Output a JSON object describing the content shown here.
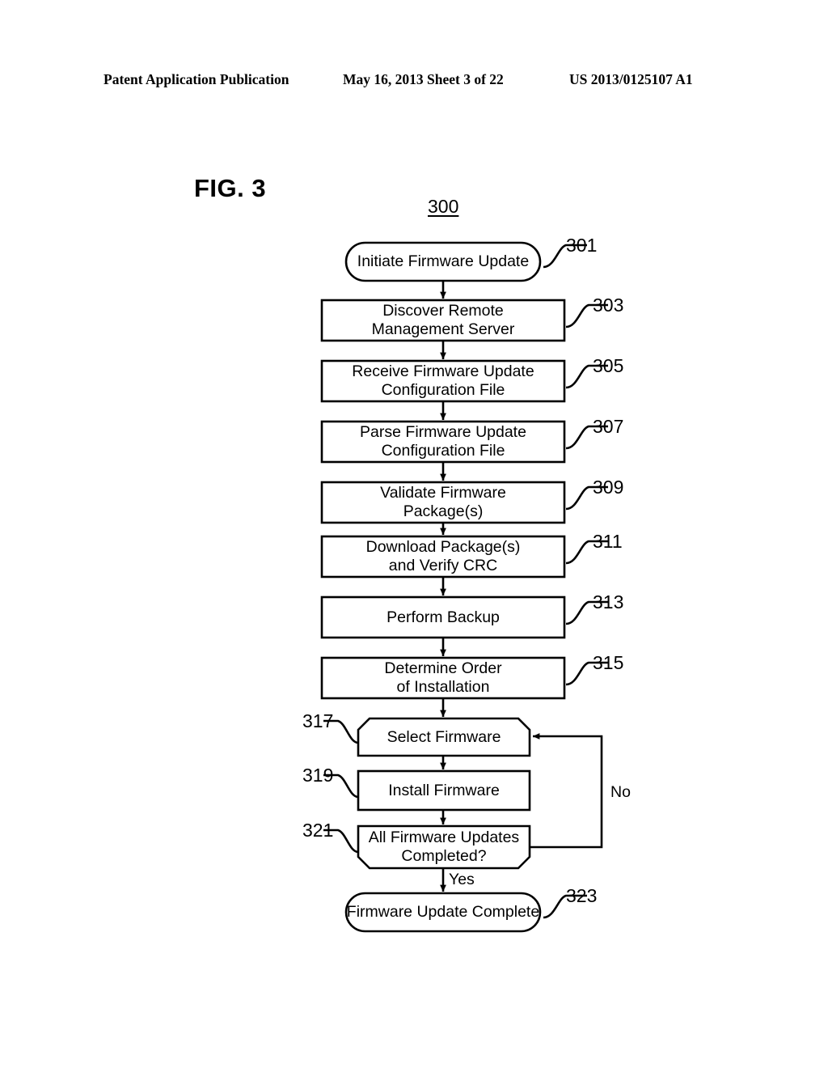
{
  "header": {
    "publication": "Patent Application Publication",
    "date_sheet": "May 16, 2013  Sheet 3 of 22",
    "patent_number": "US 2013/0125107 A1"
  },
  "figure": {
    "title": "FIG. 3",
    "diagram_ref": "300"
  },
  "flowchart": {
    "nodes": [
      {
        "id": "n301",
        "ref": "301",
        "shape": "stadium",
        "label": "Initiate Firmware Update"
      },
      {
        "id": "n303",
        "ref": "303",
        "shape": "rect",
        "label": "Discover Remote\nManagement Server"
      },
      {
        "id": "n305",
        "ref": "305",
        "shape": "rect",
        "label": "Receive Firmware Update\nConfiguration File"
      },
      {
        "id": "n307",
        "ref": "307",
        "shape": "rect",
        "label": "Parse Firmware Update\nConfiguration File"
      },
      {
        "id": "n309",
        "ref": "309",
        "shape": "rect",
        "label": "Validate Firmware\nPackage(s)"
      },
      {
        "id": "n311",
        "ref": "311",
        "shape": "rect",
        "label": "Download Package(s)\nand Verify CRC"
      },
      {
        "id": "n313",
        "ref": "313",
        "shape": "rect",
        "label": "Perform Backup"
      },
      {
        "id": "n315",
        "ref": "315",
        "shape": "rect",
        "label": "Determine Order\nof Installation"
      },
      {
        "id": "n317",
        "ref": "317",
        "shape": "chamfer-top",
        "label": "Select Firmware"
      },
      {
        "id": "n319",
        "ref": "319",
        "shape": "rect",
        "label": "Install Firmware"
      },
      {
        "id": "n321",
        "ref": "321",
        "shape": "chamfer-bottom",
        "label": "All Firmware Updates\nCompleted?"
      },
      {
        "id": "n323",
        "ref": "323",
        "shape": "stadium",
        "label": "Firmware Update Complete"
      }
    ],
    "edge_labels": {
      "yes": "Yes",
      "no": "No"
    }
  }
}
